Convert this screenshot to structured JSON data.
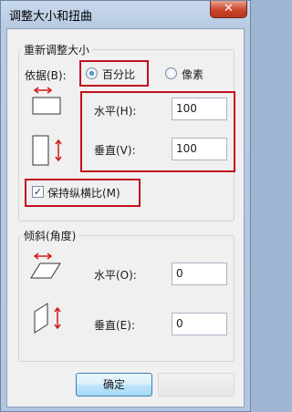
{
  "window": {
    "title": "调整大小和扭曲",
    "close_glyph": "✕"
  },
  "resize": {
    "group_title": "重新调整大小",
    "by_label": "依据(B):",
    "options": [
      {
        "label": "百分比",
        "selected": true
      },
      {
        "label": "像素",
        "selected": false
      }
    ],
    "horizontal_label": "水平(H):",
    "horizontal_value": "100",
    "vertical_label": "垂直(V):",
    "vertical_value": "100",
    "maintain_aspect_label": "保持纵横比(M)",
    "maintain_aspect_checked": true
  },
  "skew": {
    "group_title": "倾斜(角度)",
    "horizontal_label": "水平(O):",
    "horizontal_value": "0",
    "vertical_label": "垂直(E):",
    "vertical_value": "0"
  },
  "buttons": {
    "ok_label": "确定"
  },
  "icons": {
    "resize_horizontal": "horizontal-resize-icon",
    "resize_vertical": "vertical-resize-icon",
    "skew_horizontal": "horizontal-skew-icon",
    "skew_vertical": "vertical-skew-icon"
  },
  "colors": {
    "highlight_box": "#c0111d",
    "arrow": "#d01a1a"
  }
}
